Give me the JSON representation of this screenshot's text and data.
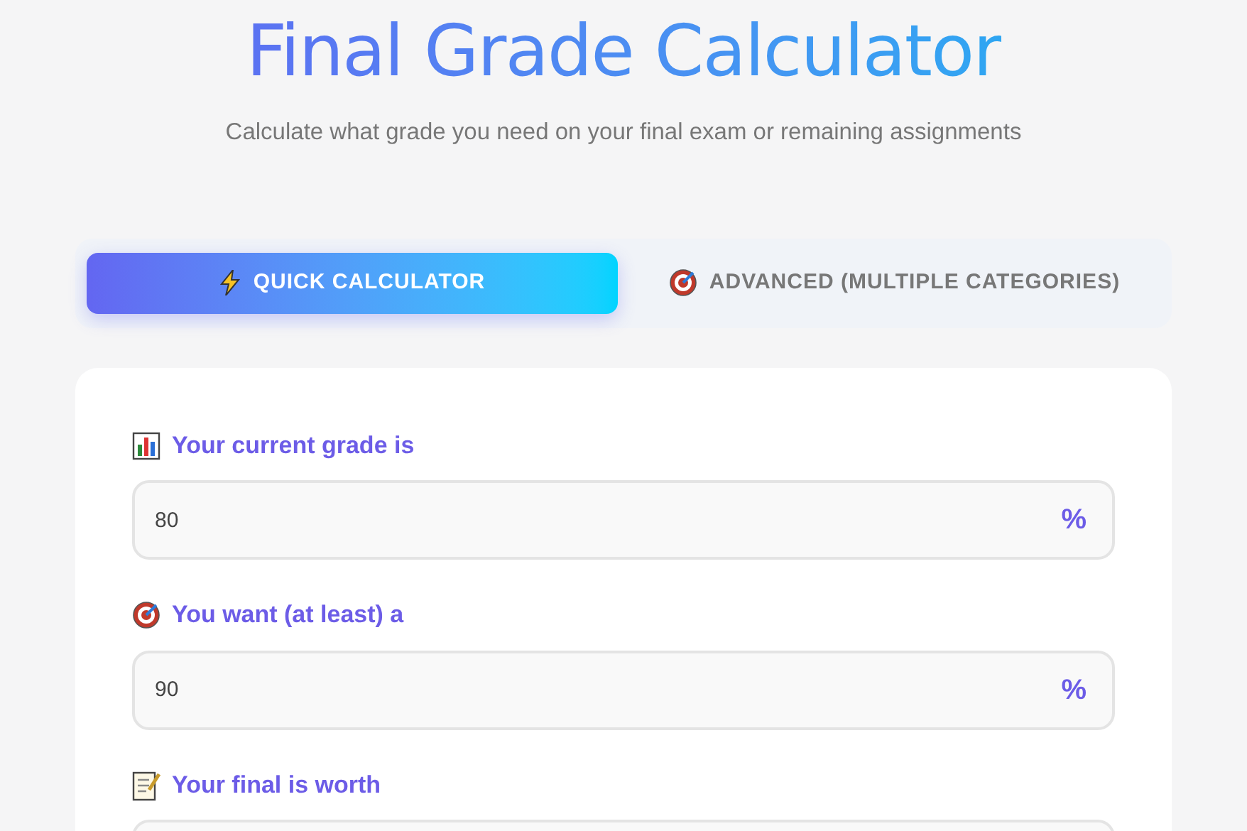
{
  "header": {
    "title": "Final Grade Calculator",
    "subtitle": "Calculate what grade you need on your final exam or remaining assignments"
  },
  "tabs": [
    {
      "label": "QUICK CALCULATOR",
      "selected": true
    },
    {
      "label": "ADVANCED (MULTIPLE CATEGORIES)",
      "selected": false
    }
  ],
  "fields": [
    {
      "label": "Your current grade is",
      "value": "80",
      "unit": "%"
    },
    {
      "label": "You want (at least) a",
      "value": "90",
      "unit": "%"
    },
    {
      "label": "Your final is worth"
    }
  ]
}
